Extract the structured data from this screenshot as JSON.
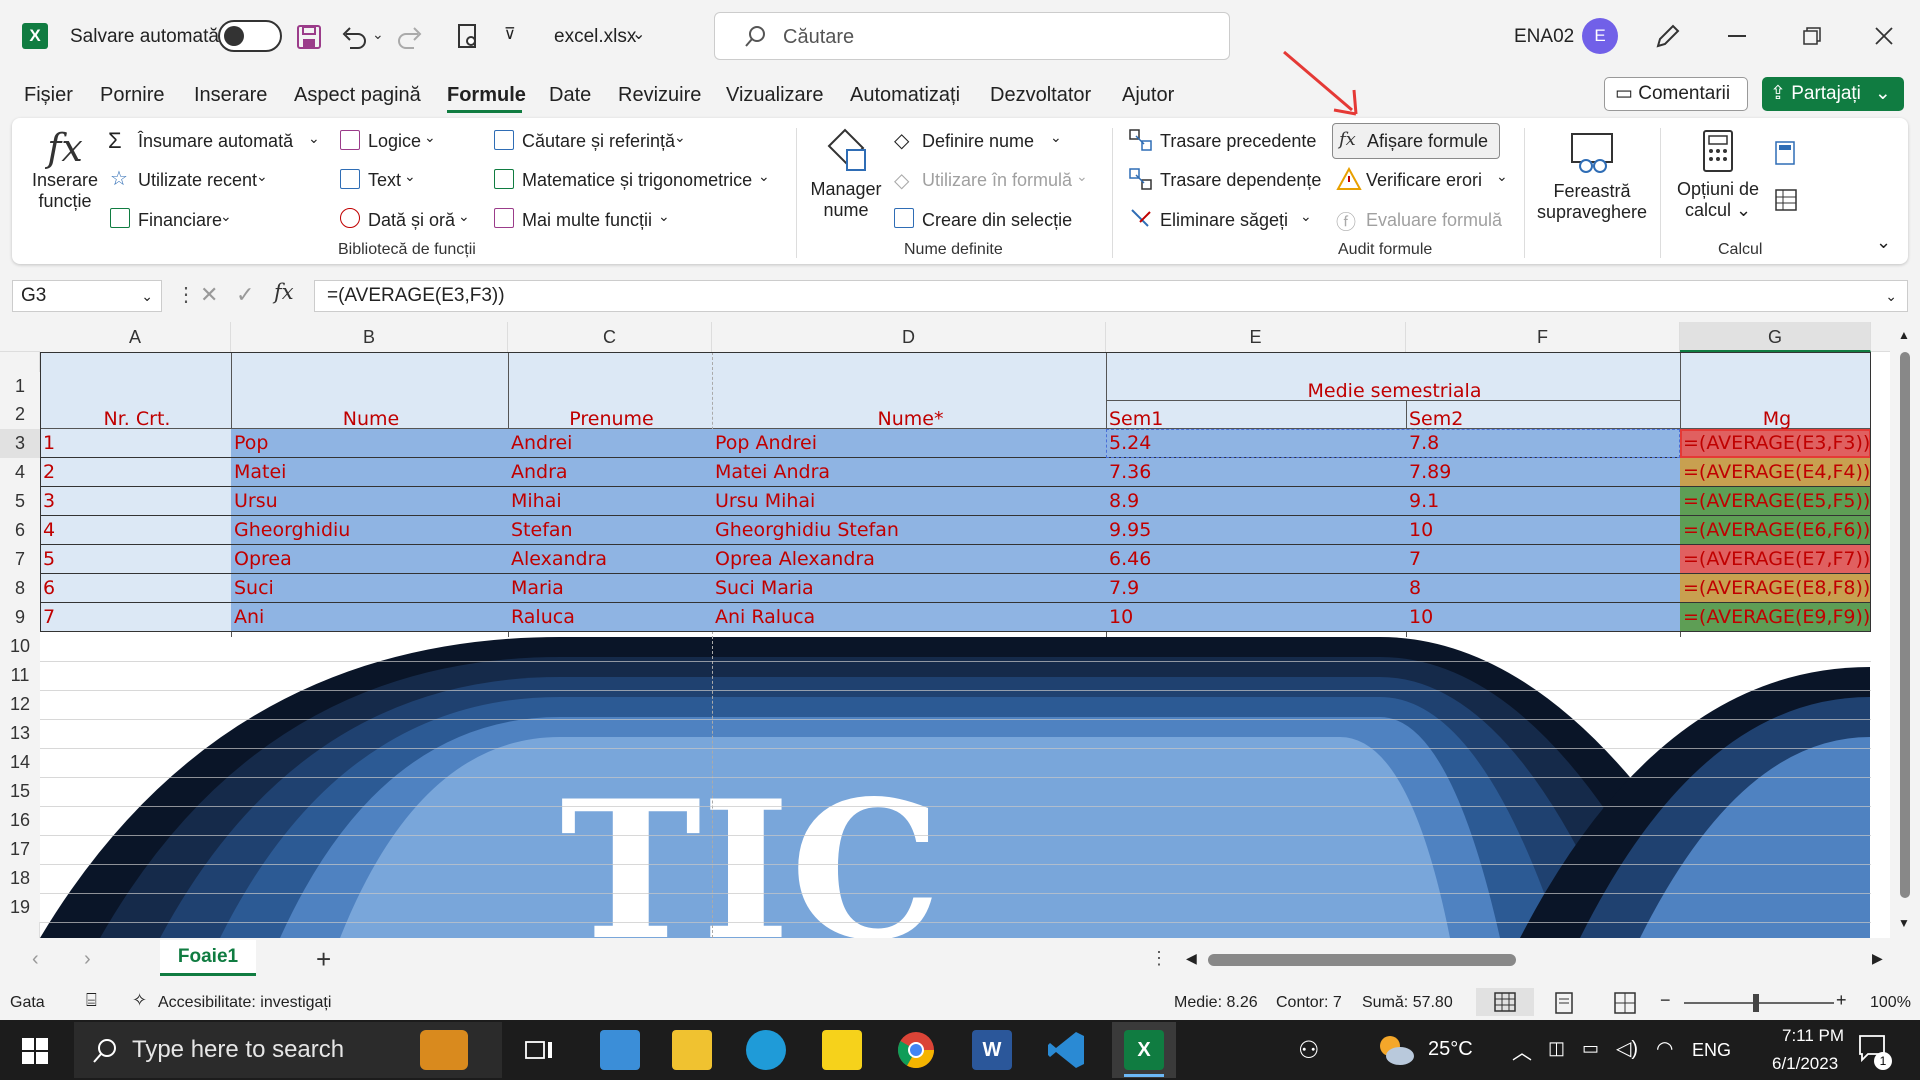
{
  "title": {
    "autosave_label": "Salvare automată",
    "filename": "excel.xlsx",
    "search_placeholder": "Căutare",
    "user_name": "ENA02",
    "avatar_initial": "E"
  },
  "menu": {
    "items": [
      "Fișier",
      "Pornire",
      "Inserare",
      "Aspect pagină",
      "Formule",
      "Date",
      "Revizuire",
      "Vizualizare",
      "Automatizați",
      "Dezvoltator",
      "Ajutor"
    ],
    "active": "Formule",
    "comments": "Comentarii",
    "share": "Partajați"
  },
  "ribbon": {
    "insert_function": [
      "Inserare",
      "funcție"
    ],
    "autosum": "Însumare automată",
    "recent": "Utilizate recent",
    "financial": "Financiare",
    "logical": "Logice",
    "text": "Text",
    "datetime": "Dată și oră",
    "lookup": "Căutare și referință",
    "math": "Matematice și trigonometrice",
    "more": "Mai multe funcții",
    "group_library": "Bibliotecă de funcții",
    "name_manager": [
      "Manager",
      "nume"
    ],
    "define_name": "Definire nume",
    "use_in_formula": "Utilizare în formulă",
    "create_from_selection": "Creare din selecție",
    "group_names": "Nume definite",
    "trace_precedents": "Trasare precedente",
    "trace_dependents": "Trasare dependențe",
    "remove_arrows": "Eliminare săgeți",
    "show_formulas": "Afișare formule",
    "error_checking": "Verificare erori",
    "evaluate_formula": "Evaluare formulă",
    "group_audit": "Audit formule",
    "watch_window": [
      "Fereastră",
      "supraveghere"
    ],
    "calc_options": [
      "Opțiuni de",
      "calcul"
    ],
    "group_calc": "Calcul"
  },
  "formula_bar": {
    "name_box": "G3",
    "formula": "=(AVERAGE(E3,F3))"
  },
  "sheet": {
    "columns": [
      "A",
      "B",
      "C",
      "D",
      "E",
      "F",
      "G"
    ],
    "row_numbers": [
      "1",
      "2",
      "3",
      "4",
      "5",
      "6",
      "7",
      "8",
      "9",
      "10",
      "11",
      "12",
      "13",
      "14",
      "15",
      "16",
      "17",
      "18",
      "19"
    ],
    "merged_header": "Medie semestriala",
    "headers": [
      "Nr. Crt.",
      "Nume",
      "Prenume",
      "Nume*",
      "Sem1",
      "Sem2",
      "Mg"
    ],
    "rows": [
      [
        "1",
        "Pop",
        "Andrei",
        "Pop Andrei",
        "5.24",
        "7.8",
        "=(AVERAGE(E3,F3))"
      ],
      [
        "2",
        "Matei",
        "Andra",
        "Matei Andra",
        "7.36",
        "7.89",
        "=(AVERAGE(E4,F4))"
      ],
      [
        "3",
        "Ursu",
        "Mihai",
        "Ursu Mihai",
        "8.9",
        "9.1",
        "=(AVERAGE(E5,F5))"
      ],
      [
        "4",
        "Gheorghidiu",
        "Stefan",
        "Gheorghidiu Stefan",
        "9.95",
        "10",
        "=(AVERAGE(E6,F6))"
      ],
      [
        "5",
        "Oprea",
        "Alexandra",
        "Oprea Alexandra",
        "6.46",
        "7",
        "=(AVERAGE(E7,F7))"
      ],
      [
        "6",
        "Suci",
        "Maria",
        "Suci Maria",
        "7.9",
        "8",
        "=(AVERAGE(E8,F8))"
      ],
      [
        "7",
        "Ani",
        "Raluca",
        "Ani Raluca",
        "10",
        "10",
        "=(AVERAGE(E9,F9))"
      ]
    ],
    "mg_colors": [
      "#e06060",
      "#c8a050",
      "#5e9e55",
      "#5e9e55",
      "#e06060",
      "#c8a050",
      "#5e9e55"
    ],
    "background_text": "TIC"
  },
  "tabs": {
    "sheet_name": "Foaie1",
    "add": "+"
  },
  "status": {
    "ready": "Gata",
    "accessibility": "Accesibilitate: investigați",
    "average": "Medie: 8.26",
    "count": "Contor: 7",
    "sum": "Sumă: 57.80",
    "zoom": "100%"
  },
  "taskbar": {
    "search": "Type here to search",
    "weather": "25°C",
    "lang": "ENG",
    "time": "7:11 PM",
    "date": "6/1/2023",
    "notifications": "1"
  },
  "colors": {
    "excel_green": "#107c41",
    "cell_text": "#c00000",
    "accent_red": "#e53935"
  }
}
